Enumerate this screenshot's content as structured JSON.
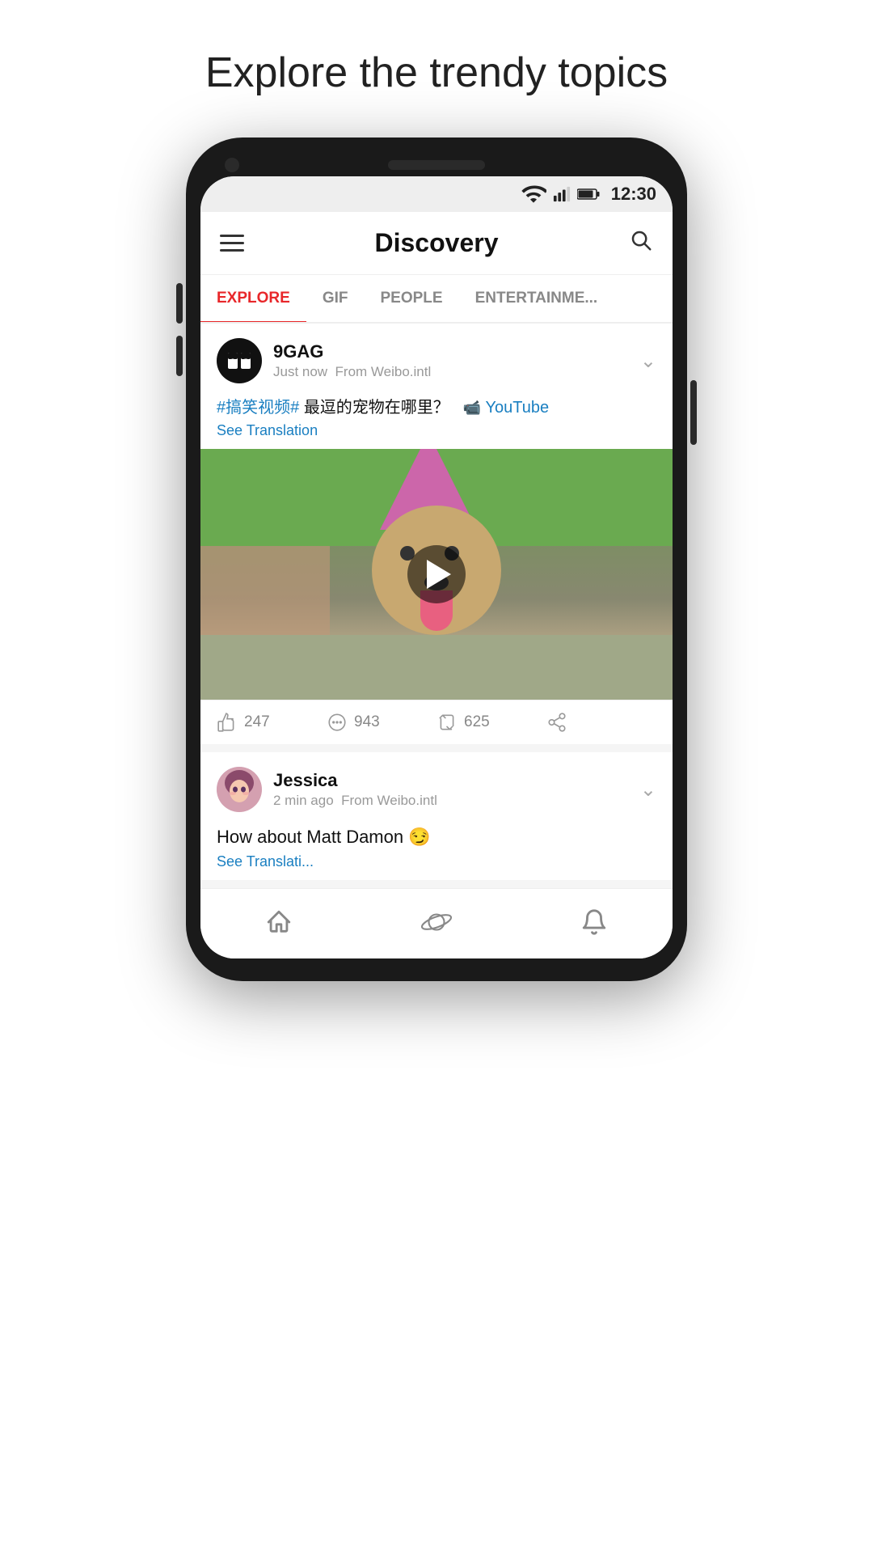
{
  "page": {
    "heading": "Explore the trendy topics"
  },
  "statusBar": {
    "time": "12:30"
  },
  "appHeader": {
    "title": "Discovery",
    "searchLabel": "search"
  },
  "tabs": [
    {
      "id": "explore",
      "label": "EXPLORE",
      "active": true
    },
    {
      "id": "gif",
      "label": "GIF",
      "active": false
    },
    {
      "id": "people",
      "label": "PEOPLE",
      "active": false
    },
    {
      "id": "entertainment",
      "label": "ENTERTAINME...",
      "active": false
    }
  ],
  "posts": [
    {
      "id": "post1",
      "username": "9GAG",
      "time": "Just now",
      "source": "From Weibo.intl",
      "hashtag": "#搞笑视频#",
      "textMiddle": " 最逗的宠物在哪里？",
      "youtubeLabel": "YouTube",
      "seeTranslation": "See Translation",
      "likes": "247",
      "comments": "943",
      "shares": "625",
      "hasVideo": true
    },
    {
      "id": "post2",
      "username": "Jessica",
      "time": "2 min ago",
      "source": "From Weibo.intl",
      "text": "How about Matt Damon",
      "emoji": "😏",
      "seeTranslation": "See Translati..."
    }
  ],
  "bottomNav": [
    {
      "id": "home",
      "label": "Home"
    },
    {
      "id": "discover",
      "label": "Discover"
    },
    {
      "id": "notifications",
      "label": "Notifications"
    }
  ],
  "colors": {
    "activeTab": "#e8272a",
    "hashtag": "#1a7fc1",
    "youtube": "#1a7fc1",
    "translation": "#1a7fc1"
  }
}
